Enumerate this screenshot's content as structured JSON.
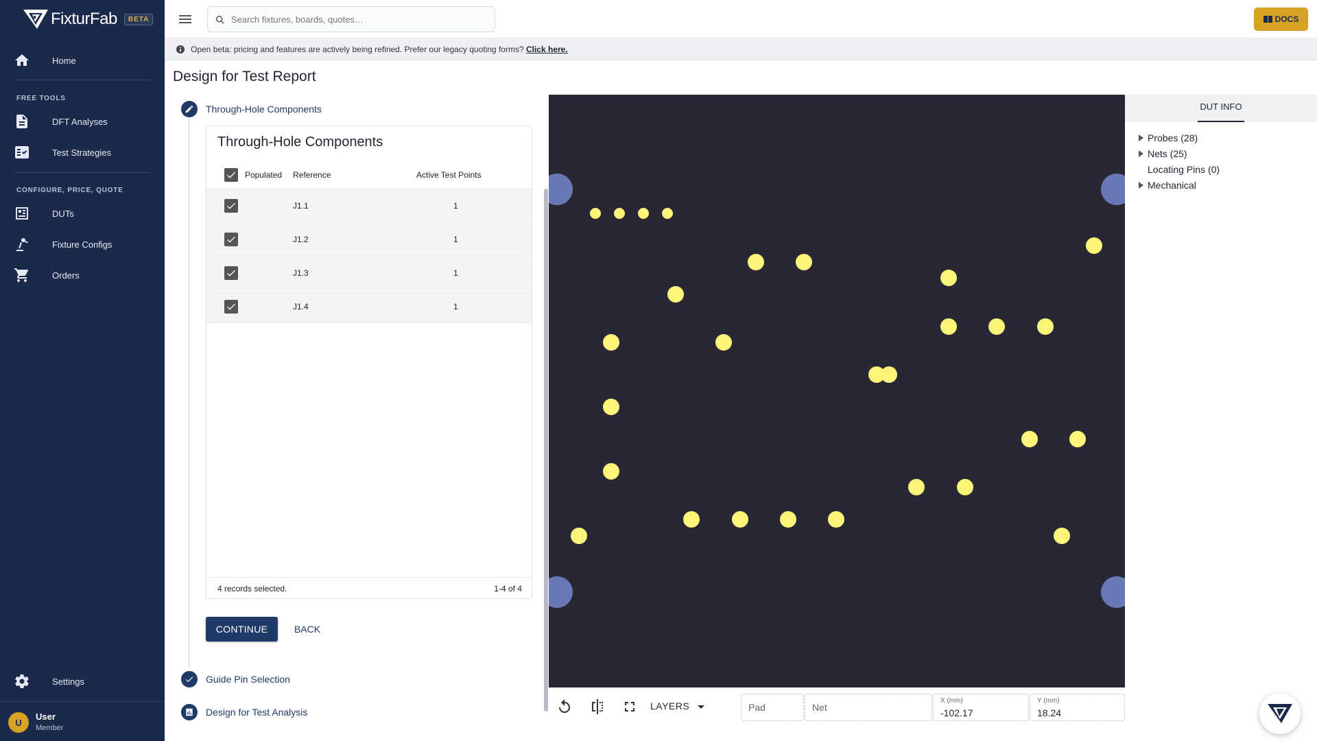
{
  "app": {
    "name": "FixturFab",
    "badge": "BETA"
  },
  "search": {
    "placeholder": "Search fixtures, boards, quotes…"
  },
  "header": {
    "docs_label": "DOCS"
  },
  "banner": {
    "text": "Open beta: pricing and features are actively being refined. Prefer our legacy quoting forms?",
    "link": "Click here."
  },
  "sidebar": {
    "home": "Home",
    "section_free_tools": "FREE TOOLS",
    "dft_analyses": "DFT Analyses",
    "test_strategies": "Test Strategies",
    "section_cpq": "CONFIGURE, PRICE, QUOTE",
    "duts": "DUTs",
    "fixture_configs": "Fixture Configs",
    "orders": "Orders",
    "settings": "Settings",
    "user_initial": "U",
    "user_name": "User",
    "user_role": "Member"
  },
  "page": {
    "title": "Design for Test Report"
  },
  "steps": [
    {
      "label": "Through-Hole Components"
    },
    {
      "label": "Guide Pin Selection"
    },
    {
      "label": "Design for Test Analysis"
    }
  ],
  "table": {
    "title": "Through-Hole Components",
    "columns": {
      "populated": "Populated",
      "reference": "Reference",
      "active": "Active Test Points"
    },
    "rows": [
      {
        "reference": "J1.1",
        "active": "1",
        "populated": true
      },
      {
        "reference": "J1.2",
        "active": "1",
        "populated": true
      },
      {
        "reference": "J1.3",
        "active": "1",
        "populated": true
      },
      {
        "reference": "J1.4",
        "active": "1",
        "populated": true
      }
    ],
    "selected_text": "4 records selected.",
    "range_text": "1-4 of 4"
  },
  "actions": {
    "continue": "CONTINUE",
    "back": "BACK"
  },
  "viewer": {
    "layers": "LAYERS",
    "pad_placeholder": "Pad",
    "net_placeholder": "Net",
    "x_label": "X (mm)",
    "x_value": "-102.17",
    "y_label": "Y (mm)",
    "y_value": "18.24",
    "colors": {
      "background": "#272834",
      "probe": "#fdf57a",
      "tooling_hole": "#6b78b6"
    }
  },
  "dut_info": {
    "tab": "DUT INFO",
    "probes": "Probes (28)",
    "nets": "Nets (25)",
    "locating_pins": "Locating Pins (0)",
    "mechanical": "Mechanical"
  },
  "colors": {
    "sidebar": "#1b2a4a",
    "primary": "#1f3a66",
    "accent": "#d8a324"
  }
}
